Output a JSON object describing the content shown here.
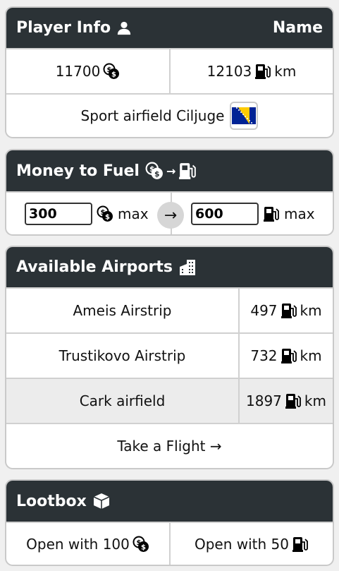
{
  "player": {
    "title": "Player Info",
    "name_label": "Name",
    "money": "11700",
    "fuel": "12103",
    "fuel_unit": "km",
    "location": "Sport airfield Ciljuge"
  },
  "converter": {
    "title": "Money to Fuel",
    "money_value": "300",
    "money_max": "max",
    "fuel_value": "600",
    "fuel_max": "max"
  },
  "airports": {
    "title": "Available Airports",
    "items": [
      {
        "name": "Ameis Airstrip",
        "distance": "497",
        "unit": "km"
      },
      {
        "name": "Trustikovo Airstrip",
        "distance": "732",
        "unit": "km"
      },
      {
        "name": "Cark airfield",
        "distance": "1897",
        "unit": "km"
      }
    ],
    "action": "Take a Flight →"
  },
  "lootbox": {
    "title": "Lootbox",
    "open_money": "Open with 100",
    "open_fuel": "Open with 50"
  },
  "colors": {
    "header": "#2b3236",
    "highlight_row": "#ececec",
    "border": "#c9c9c9"
  }
}
